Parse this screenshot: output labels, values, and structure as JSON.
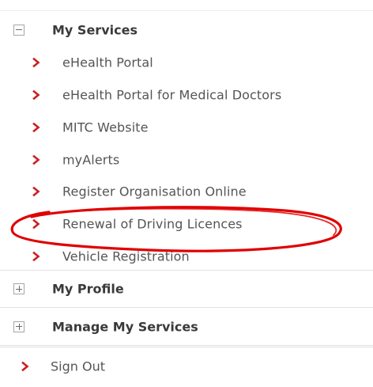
{
  "menu": {
    "my_services": {
      "label": "My Services",
      "expanded": true,
      "items": [
        {
          "label": "eHealth Portal"
        },
        {
          "label": "eHealth Portal for Medical Doctors"
        },
        {
          "label": "MITC Website"
        },
        {
          "label": "myAlerts"
        },
        {
          "label": "Register Organisation Online"
        },
        {
          "label": "Renewal of Driving Licences"
        },
        {
          "label": "Vehicle Registration"
        }
      ]
    },
    "my_profile": {
      "label": "My Profile",
      "expanded": false
    },
    "manage_my_services": {
      "label": "Manage My Services",
      "expanded": false
    },
    "sign_out": {
      "label": "Sign Out"
    }
  },
  "colors": {
    "chevron": "#cc1f1f",
    "annotation_ellipse": "#e00000",
    "header_text": "#3a3a3a",
    "item_text": "#555555",
    "border": "#e1e1e1"
  },
  "icons": {
    "collapse": "minus-box-icon",
    "expand": "plus-box-icon",
    "bullet": "chevron-right-icon"
  }
}
